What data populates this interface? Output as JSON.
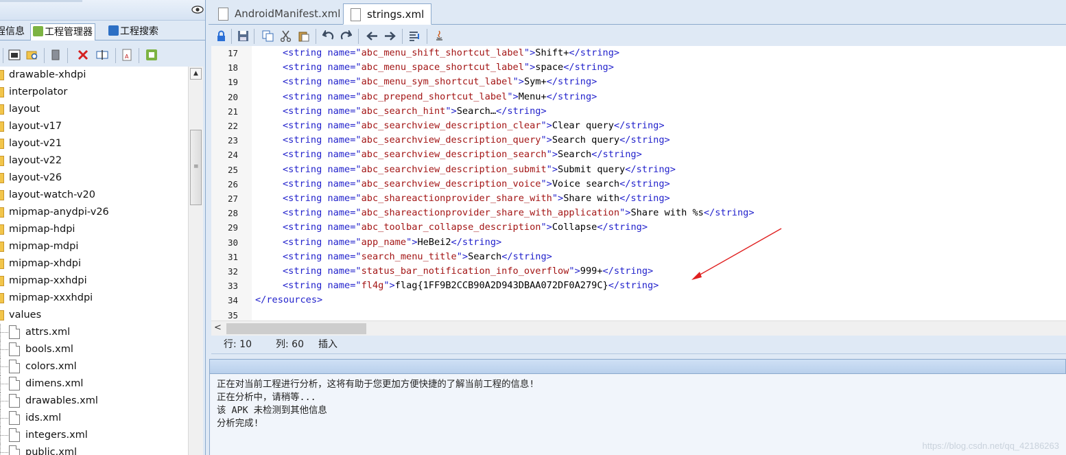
{
  "left_panel": {
    "tabs": [
      {
        "label": "程信息",
        "active": false
      },
      {
        "label": "工程管理器",
        "active": true
      },
      {
        "label": "工程搜索",
        "active": false
      }
    ],
    "tree": {
      "folders": [
        "drawable-xhdpi",
        "interpolator",
        "layout",
        "layout-v17",
        "layout-v21",
        "layout-v22",
        "layout-v26",
        "layout-watch-v20",
        "mipmap-anydpi-v26",
        "mipmap-hdpi",
        "mipmap-mdpi",
        "mipmap-xhdpi",
        "mipmap-xxhdpi",
        "mipmap-xxxhdpi",
        "values"
      ],
      "files": [
        "attrs.xml",
        "bools.xml",
        "colors.xml",
        "dimens.xml",
        "drawables.xml",
        "ids.xml",
        "integers.xml",
        "public.xml"
      ]
    },
    "scrollbar": {
      "grip": "≡"
    }
  },
  "editor": {
    "tabs": [
      {
        "label": "AndroidManifest.xml",
        "active": false
      },
      {
        "label": "strings.xml",
        "active": true
      }
    ],
    "lines": [
      {
        "n": "17",
        "name": "abc_menu_shift_shortcut_label",
        "text": "Shift+"
      },
      {
        "n": "18",
        "name": "abc_menu_space_shortcut_label",
        "text": "space"
      },
      {
        "n": "19",
        "name": "abc_menu_sym_shortcut_label",
        "text": "Sym+"
      },
      {
        "n": "20",
        "name": "abc_prepend_shortcut_label",
        "text": "Menu+"
      },
      {
        "n": "21",
        "name": "abc_search_hint",
        "text": "Search…"
      },
      {
        "n": "22",
        "name": "abc_searchview_description_clear",
        "text": "Clear query"
      },
      {
        "n": "23",
        "name": "abc_searchview_description_query",
        "text": "Search query"
      },
      {
        "n": "24",
        "name": "abc_searchview_description_search",
        "text": "Search"
      },
      {
        "n": "25",
        "name": "abc_searchview_description_submit",
        "text": "Submit query"
      },
      {
        "n": "26",
        "name": "abc_searchview_description_voice",
        "text": "Voice search"
      },
      {
        "n": "27",
        "name": "abc_shareactionprovider_share_with",
        "text": "Share with"
      },
      {
        "n": "28",
        "name": "abc_shareactionprovider_share_with_application",
        "text": "Share with %s"
      },
      {
        "n": "29",
        "name": "abc_toolbar_collapse_description",
        "text": "Collapse"
      },
      {
        "n": "30",
        "name": "app_name",
        "text": "HeBei2"
      },
      {
        "n": "31",
        "name": "search_menu_title",
        "text": "Search"
      },
      {
        "n": "32",
        "name": "status_bar_notification_info_overflow",
        "text": "999+"
      },
      {
        "n": "33",
        "name": "fl4g",
        "text": "flag{1FF9B2CCB90A2D943DBAA072DF0A279C}"
      }
    ],
    "closing_line": {
      "n": "34",
      "text": "</resources>"
    },
    "empty_line": {
      "n": "35"
    },
    "syntax": {
      "tag_open": "<string name=\"",
      "tag_mid": "\">",
      "tag_close": "</string>"
    },
    "hscroll_arrow": "<"
  },
  "status": {
    "row": "行: 10",
    "col": "列: 60",
    "mode": "插入"
  },
  "output": {
    "lines": [
      "正在对当前工程进行分析，这将有助于您更加方便快捷的了解当前工程的信息!",
      "正在分析中，请稍等...",
      "该 APK 未检测到其他信息",
      "分析完成!"
    ]
  },
  "watermark": "https://blog.csdn.net/qq_42186263",
  "colors": {
    "accent": "#8ba9cc",
    "tag": "#2222cc",
    "value": "#a31515",
    "arrow": "#e02020"
  }
}
